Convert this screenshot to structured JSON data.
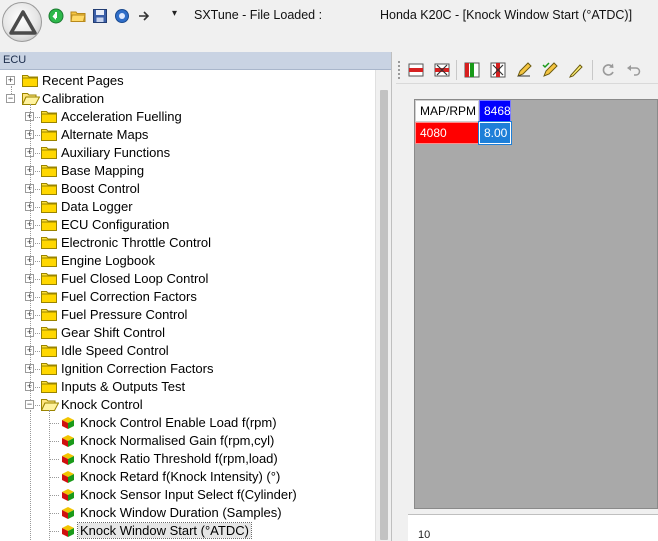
{
  "window": {
    "app_title": "SXTune - File Loaded :",
    "document_title": "Honda K20C - [Knock Window Start (°ATDC)]"
  },
  "quick_access": {
    "icons": [
      "play-icon",
      "open-folder-icon",
      "save-icon",
      "search-icon",
      "forward-icon"
    ],
    "dropdown_glyph": "▾"
  },
  "left_panel": {
    "header": "ECU",
    "tree": {
      "recent_pages": "Recent Pages",
      "calibration": "Calibration",
      "folders": [
        "Acceleration Fuelling",
        "Alternate Maps",
        "Auxiliary Functions",
        "Base Mapping",
        "Boost Control",
        "Data Logger",
        "ECU Configuration",
        "Electronic Throttle Control",
        "Engine Logbook",
        "Fuel Closed Loop Control",
        "Fuel Correction Factors",
        "Fuel Pressure Control",
        "Gear Shift Control",
        "Idle Speed Control",
        "Ignition Correction Factors",
        "Inputs & Outputs Test",
        "Knock Control"
      ],
      "knock_items": [
        "Knock Control Enable Load f(rpm)",
        "Knock Normalised Gain f(rpm,cyl)",
        "Knock Ratio Threshold f(rpm,load)",
        "Knock Retard f(Knock Intensity) (°)",
        "Knock Sensor Input Select f(Cylinder)",
        "Knock Window Duration (Samples)",
        "Knock Window Start (°ATDC)"
      ],
      "selected_item": "Knock Window Start (°ATDC)"
    }
  },
  "right_panel": {
    "toolbar_icons": [
      "insert-row-icon",
      "delete-row-icon",
      "insert-column-icon",
      "delete-column-icon",
      "edit-pencil-icon",
      "edit-pencil-check-icon",
      "highlighter-icon",
      "refresh-icon",
      "undo-icon"
    ],
    "table": {
      "header_label": "MAP/RPM",
      "rpm_value": "8468",
      "map_value": "4080",
      "cell_value": "8.00"
    },
    "lower_axis_label": "10"
  },
  "colors": {
    "panel_header_bg": "#c9d3e3",
    "rpm_header_bg": "#0000ff",
    "map_row_bg": "#ff0000",
    "cell_bg": "#1e7fd8",
    "grid_bg": "#a9a9a9"
  }
}
